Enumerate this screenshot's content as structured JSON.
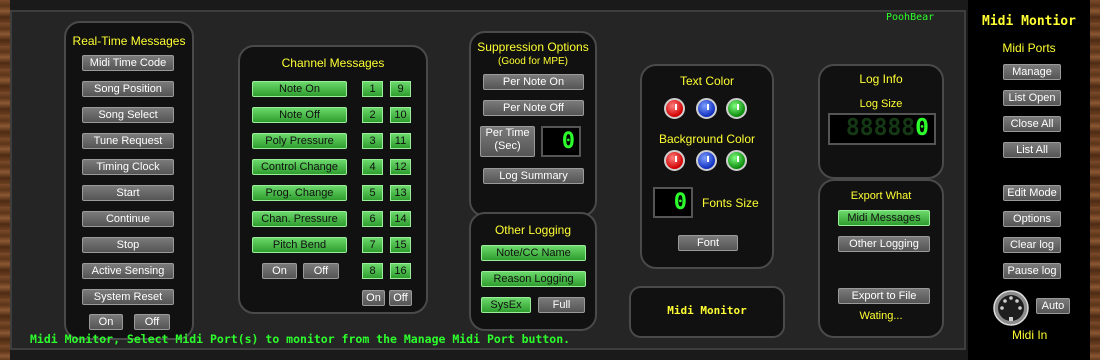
{
  "app": {
    "author": "PoohBear",
    "status": "Midi Monitor, Select Midi Port(s) to monitor from the Manage Midi Port button."
  },
  "realtime": {
    "title": "Real-Time Messages",
    "items": [
      "Midi Time Code",
      "Song Position",
      "Song Select",
      "Tune Request",
      "Timing Clock",
      "Start",
      "Continue",
      "Stop",
      "Active Sensing",
      "System Reset"
    ],
    "on": "On",
    "off": "Off"
  },
  "channel": {
    "title": "Channel Messages",
    "items": [
      "Note On",
      "Note Off",
      "Poly Pressure",
      "Control Change",
      "Prog. Change",
      "Chan. Pressure",
      "Pitch Bend"
    ],
    "channels": [
      "1",
      "2",
      "3",
      "4",
      "5",
      "6",
      "7",
      "8",
      "9",
      "10",
      "11",
      "12",
      "13",
      "14",
      "15",
      "16"
    ],
    "on": "On",
    "off": "Off",
    "on2": "On",
    "off2": "Off"
  },
  "suppression": {
    "title": "Suppression Options",
    "subtitle": "(Good for MPE)",
    "per_note_on": "Per Note On",
    "per_note_off": "Per Note Off",
    "per_time_1": "Per Time",
    "per_time_2": "(Sec)",
    "per_time_value": "0",
    "log_summary": "Log Summary"
  },
  "other_logging": {
    "title": "Other Logging",
    "note_cc": "Note/CC Name",
    "reason": "Reason Logging",
    "sysex": "SysEx",
    "full": "Full"
  },
  "monitor_label": "Midi Monitor",
  "colors": {
    "text_title": "Text Color",
    "bg_title": "Background Color",
    "knobs": [
      "red",
      "blue",
      "green"
    ],
    "fonts_size_label": "Fonts Size",
    "fonts_size_value": "0",
    "font_button": "Font"
  },
  "log_info": {
    "title": "Log Info",
    "size_label": "Log Size",
    "size_value": "0"
  },
  "export": {
    "title": "Export What",
    "midi_messages": "Midi Messages",
    "other_logging": "Other Logging",
    "export_to_file": "Export to File",
    "status": "Wating..."
  },
  "right_panel": {
    "title": "Midi Montior",
    "ports_label": "Midi Ports",
    "port_buttons": [
      "Manage",
      "List Open",
      "Close All",
      "List All"
    ],
    "mode_buttons": [
      "Edit Mode",
      "Options",
      "Clear log",
      "Pause log"
    ],
    "auto": "Auto",
    "midi_in": "Midi In"
  },
  "accent_colors": {
    "green_button": "#4cc94c",
    "lcd_green": "#2cff2c",
    "title_yellow": "#ffff33"
  }
}
